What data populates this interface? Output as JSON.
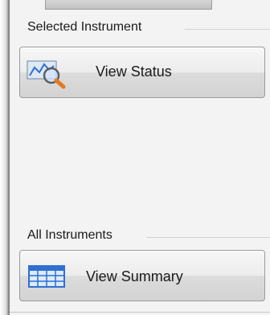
{
  "selected_section": {
    "title": "Selected Instrument",
    "button_label": "View Status",
    "button_icon": "graph-magnifier-icon"
  },
  "all_section": {
    "title": "All Instruments",
    "button_label": "View Summary",
    "button_icon": "table-grid-icon"
  },
  "colors": {
    "panel_background": "#f3f3f3",
    "button_border": "#9a9a9a",
    "table_icon_blue": "#2f6fd0",
    "magnifier_orange": "#e07a1e"
  }
}
